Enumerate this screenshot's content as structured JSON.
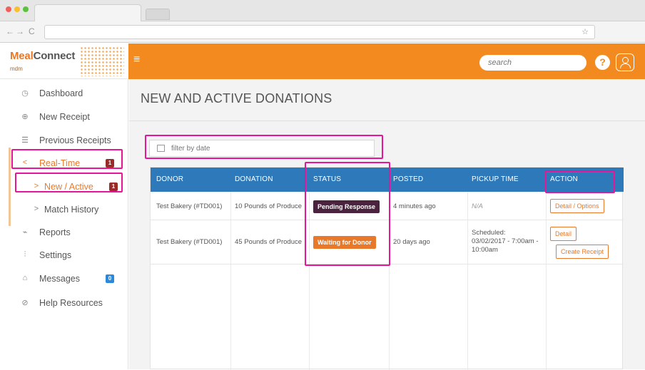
{
  "browser": {
    "nav_back": "←",
    "nav_forward": "→",
    "nav_reload": "C",
    "star": "☆"
  },
  "header": {
    "logo_meal": "Meal",
    "logo_connect": "Connect",
    "logo_sub": "mdm",
    "hamburger": "≡",
    "search_placeholder": "search",
    "help": "?"
  },
  "sidebar": {
    "items": [
      {
        "icon": "◷",
        "label": "Dashboard"
      },
      {
        "icon": "⊕",
        "label": "New Receipt"
      },
      {
        "icon": "☰",
        "label": "Previous Receipts"
      },
      {
        "icon": "<",
        "label": "Real-Time",
        "badge": "1"
      },
      {
        "icon": ">",
        "label": "New / Active",
        "badge": "1"
      },
      {
        "icon": ">",
        "label": "Match History"
      },
      {
        "icon": "⌁",
        "label": "Reports"
      },
      {
        "icon": "⫶",
        "label": "Settings"
      },
      {
        "icon": "⌂",
        "label": "Messages",
        "badge": "0"
      },
      {
        "icon": "⊘",
        "label": "Help Resources"
      }
    ]
  },
  "main": {
    "title": "NEW AND ACTIVE DONATIONS",
    "filter_placeholder": "filter by date",
    "table": {
      "headers": [
        "DONOR",
        "DONATION",
        "STATUS",
        "POSTED",
        "PICKUP TIME",
        "ACTION"
      ],
      "rows": [
        {
          "donor": "Test Bakery (#TD001)",
          "donation": "10 Pounds of Produce",
          "status": "Pending Response",
          "posted": "4 minutes ago",
          "pickup": "N/A",
          "actions": [
            "Detail / Options"
          ]
        },
        {
          "donor": "Test Bakery (#TD001)",
          "donation": "45 Pounds of Produce",
          "status": "Waiting for Donor",
          "posted": "20 days ago",
          "pickup_line1": "Scheduled:",
          "pickup_line2": "03/02/2017 - 7:00am -",
          "pickup_line3": "10:00am",
          "actions": [
            "Detail",
            "Create Receipt"
          ]
        }
      ]
    }
  },
  "colors": {
    "brand_orange": "#f28a1f",
    "table_header_blue": "#2e79ba",
    "pending_badge": "#4b233e",
    "highlight_magenta": "#e6159a"
  }
}
